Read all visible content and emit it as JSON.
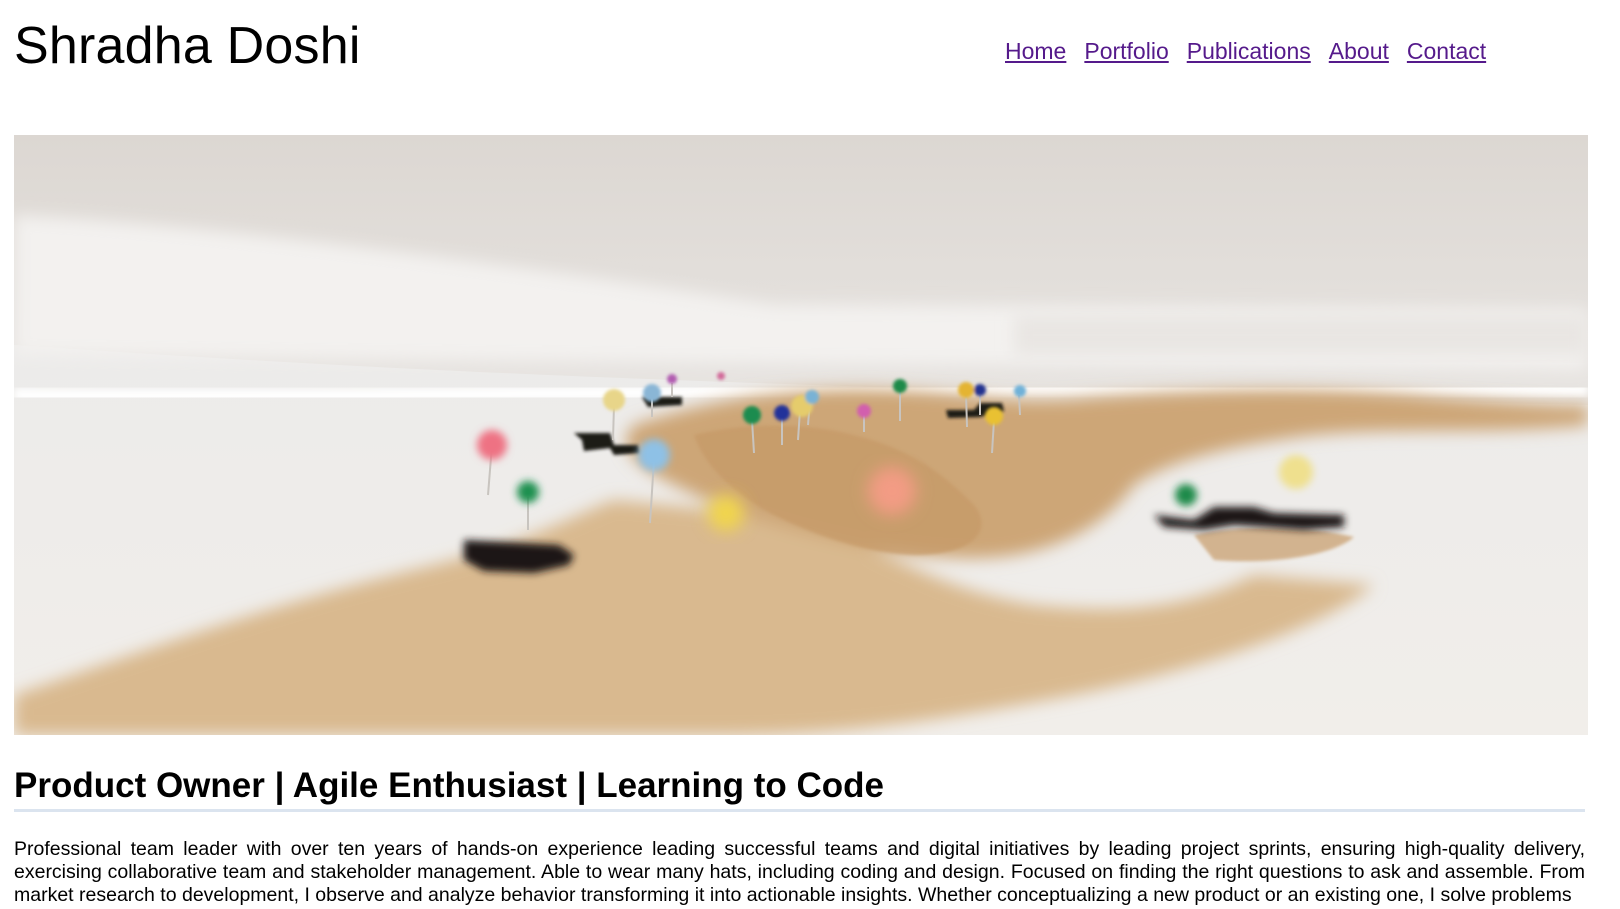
{
  "site": {
    "title": "Shradha Doshi"
  },
  "nav": {
    "items": [
      {
        "label": "Home"
      },
      {
        "label": "Portfolio"
      },
      {
        "label": "Publications"
      },
      {
        "label": "About"
      },
      {
        "label": "Contact"
      }
    ]
  },
  "hero": {
    "image_description_icon": "world-map-pins-photo"
  },
  "main": {
    "headline": "Product Owner | Agile Enthusiast | Learning to Code",
    "summary": "Professional team leader with over ten years of hands-on experience leading successful teams and digital initiatives by leading project sprints, ensuring high-quality delivery, exercising collaborative team and stakeholder management. Able to wear many hats, including coding and design. Focused on finding the right questions to ask and assemble. From market research to development, I observe and analyze behavior transforming it into actionable insights. Whether conceptualizing a new product or an existing one, I solve problems"
  },
  "colors": {
    "link": "#551a8b",
    "divider": "#dbe4ef",
    "map_cork": "#c9a273",
    "background_wall": "#e4dfd9"
  }
}
